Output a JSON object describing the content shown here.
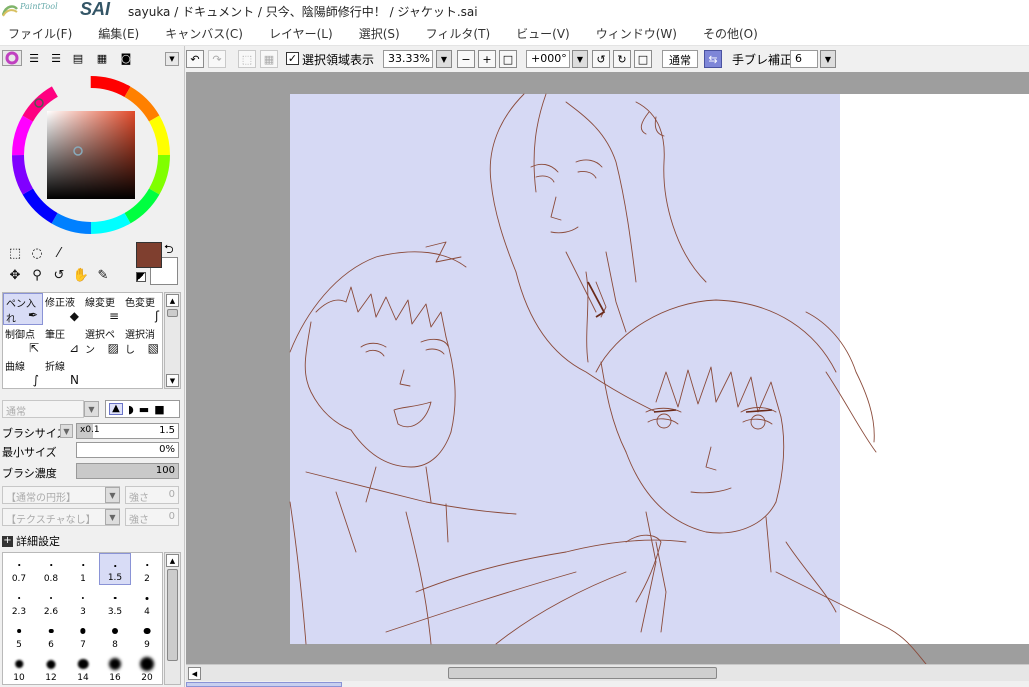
{
  "app": {
    "logo_small": "PaintTool",
    "logo_big": "SAI",
    "title": "sayuka / ドキュメント / 只今、陰陽師修行中！ / ジャケット.sai"
  },
  "menu": [
    "ファイル(F)",
    "編集(E)",
    "キャンバス(C)",
    "レイヤー(L)",
    "選択(S)",
    "フィルタ(T)",
    "ビュー(V)",
    "ウィンドウ(W)",
    "その他(O)"
  ],
  "colors": {
    "foreground": "#7f3f2f",
    "background": "#ffffff",
    "paper": "#d6d9f4",
    "line": "#8a4a3a",
    "selection": "#d8dcf6"
  },
  "brush_tools": [
    {
      "label": "ペン入れ",
      "icon": "pen-icon",
      "selected": true
    },
    {
      "label": "修正液",
      "icon": "eraser-icon",
      "selected": false
    },
    {
      "label": "線変更",
      "icon": "line-edit-icon",
      "selected": false
    },
    {
      "label": "色変更",
      "icon": "color-change-icon",
      "selected": false
    },
    {
      "label": "制御点",
      "icon": "control-point-icon",
      "selected": false
    },
    {
      "label": "筆圧",
      "icon": "pressure-icon",
      "selected": false
    },
    {
      "label": "選択ペン",
      "icon": "select-pen-icon",
      "selected": false
    },
    {
      "label": "選択消し",
      "icon": "select-erase-icon",
      "selected": false
    },
    {
      "label": "曲線",
      "icon": "curve-icon",
      "selected": false
    },
    {
      "label": "折線",
      "icon": "polyline-icon",
      "selected": false
    }
  ],
  "brush_props": {
    "blend_mode": "通常",
    "size_label": "ブラシサイズ",
    "size_multiplier": "x0.1",
    "size_value": "1.5",
    "min_size_label": "最小サイズ",
    "min_size_value": "0%",
    "density_label": "ブラシ濃度",
    "density_value": "100",
    "shape": "【通常の円形】",
    "shape_strength": "強さ",
    "shape_strength_value": "0",
    "texture": "【テクスチャなし】",
    "texture_strength": "強さ",
    "texture_strength_value": "0",
    "detail_label": "詳細設定"
  },
  "brush_sizes": [
    "0.7",
    "0.8",
    "1",
    "1.5",
    "2",
    "2.3",
    "2.6",
    "3",
    "3.5",
    "4",
    "5",
    "6",
    "7",
    "8",
    "9",
    "10",
    "12",
    "14",
    "16",
    "20"
  ],
  "selected_brush_size": "1.5",
  "canvas_toolbar": {
    "show_selection_label": "選択領域表示",
    "show_selection_checked": true,
    "zoom": "33.33%",
    "rotation": "+000°",
    "blend": "通常",
    "stabilizer_label": "手ブレ補正",
    "stabilizer_value": "6"
  }
}
